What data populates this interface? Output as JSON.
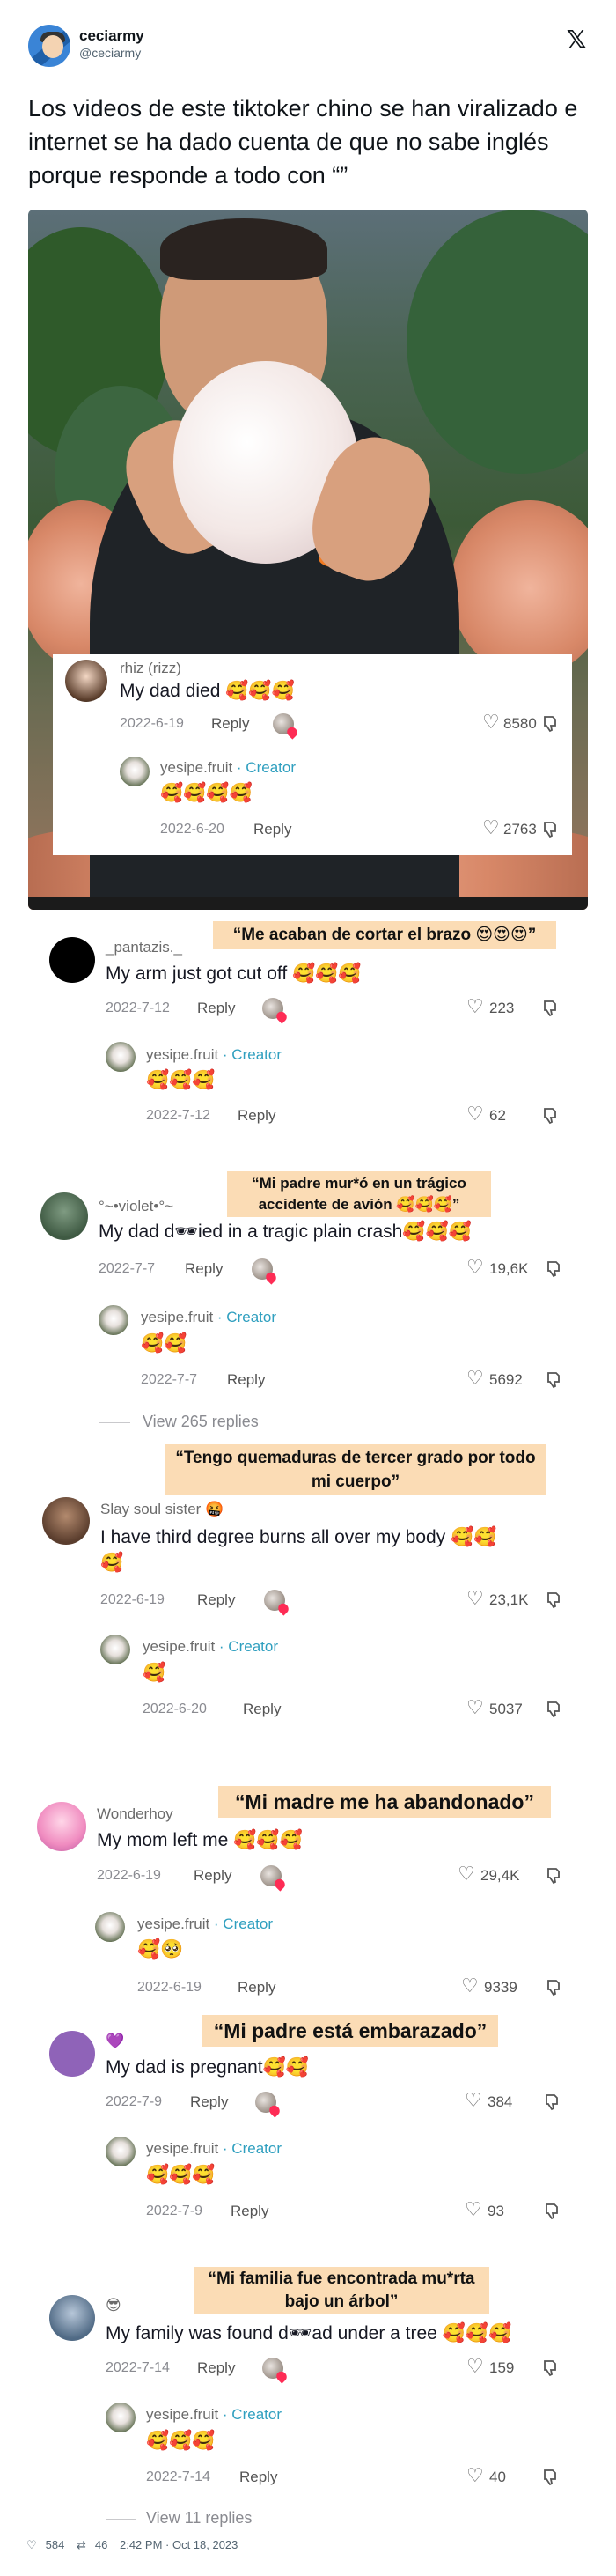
{
  "header": {
    "display_name": "ceciarmy",
    "handle": "@ceciarmy",
    "logo_icon": "x-logo-icon"
  },
  "tweet": {
    "text": "Los videos de este tiktoker chino se han viralizado e internet se ha dado cuenta de que no sabe inglés porque responde a todo con “”"
  },
  "video_overlay": {
    "comment": {
      "user": "rhiz (rizz)",
      "text": "My dad died 🥰🥰🥰",
      "date": "2022-6-19",
      "reply": "Reply",
      "likes": "8580"
    },
    "creator_reply": {
      "user": "yesipe.fruit",
      "tag": " · Creator",
      "text": "🥰🥰🥰🥰",
      "date": "2022-6-20",
      "reply": "Reply",
      "likes": "2763"
    }
  },
  "threads": [
    {
      "caption": "“Me acaban de cortar el brazo 😍😍😍”",
      "comment": {
        "user": "_pantazis._",
        "text": "My arm just got cut off 🥰🥰🥰",
        "date": "2022-7-12",
        "reply": "Reply",
        "likes": "223"
      },
      "creator_reply": {
        "user": "yesipe.fruit",
        "tag": " · Creator",
        "text": "🥰🥰🥰",
        "date": "2022-7-12",
        "reply": "Reply",
        "likes": "62"
      }
    },
    {
      "caption": "“Mi padre mur*ó en un trágico accidente de avión 🥰🥰🥰”",
      "comment": {
        "user": "°~•violet•°~",
        "text": "My dad d🕶ied in a tragic plain crash🥰🥰🥰",
        "date": "2022-7-7",
        "reply": "Reply",
        "likes": "19,6K"
      },
      "creator_reply": {
        "user": "yesipe.fruit",
        "tag": " · Creator",
        "text": "🥰🥰",
        "date": "2022-7-7",
        "reply": "Reply",
        "likes": "5692"
      },
      "view_replies": "View 265 replies"
    },
    {
      "caption": "“Tengo quemaduras de tercer grado por todo mi cuerpo”",
      "comment": {
        "user": "Slay soul sister 🤬",
        "text": "I have third degree burns all over my body 🥰🥰",
        "text2": "🥰",
        "date": "2022-6-19",
        "reply": "Reply",
        "likes": "23,1K"
      },
      "creator_reply": {
        "user": "yesipe.fruit",
        "tag": " · Creator",
        "text": "🥰",
        "date": "2022-6-20",
        "reply": "Reply",
        "likes": "5037"
      }
    },
    {
      "caption": "“Mi madre me ha abandonado”",
      "comment": {
        "user": "Wonderhoy ",
        "text": "My mom left me 🥰🥰🥰",
        "date": "2022-6-19",
        "reply": "Reply",
        "likes": "29,4K"
      },
      "creator_reply": {
        "user": "yesipe.fruit",
        "tag": " · Creator",
        "text": "🥰🥺",
        "date": "2022-6-19",
        "reply": "Reply",
        "likes": "9339"
      }
    },
    {
      "caption": "“Mi padre está embarazado”",
      "comment": {
        "user": "💜",
        "text": "My dad is pregnant🥰🥰",
        "date": "2022-7-9",
        "reply": "Reply",
        "likes": "384"
      },
      "creator_reply": {
        "user": "yesipe.fruit",
        "tag": " · Creator",
        "text": "🥰🥰🥰",
        "date": "2022-7-9",
        "reply": "Reply",
        "likes": "93"
      }
    },
    {
      "caption": "“Mi familia fue encontrada mu*rta bajo un árbol”",
      "comment": {
        "user": "😎",
        "text": "My family was found d🕶ad under a tree 🥰🥰🥰",
        "date": "2022-7-14",
        "reply": "Reply",
        "likes": "159"
      },
      "creator_reply": {
        "user": "yesipe.fruit",
        "tag": " · Creator",
        "text": "🥰🥰🥰",
        "date": "2022-7-14",
        "reply": "Reply",
        "likes": "40"
      },
      "view_replies": "View 11 replies"
    }
  ],
  "footer": {
    "likes": "584",
    "retweets": "46",
    "timestamp": "2:42 PM · Oct 18, 2023"
  }
}
